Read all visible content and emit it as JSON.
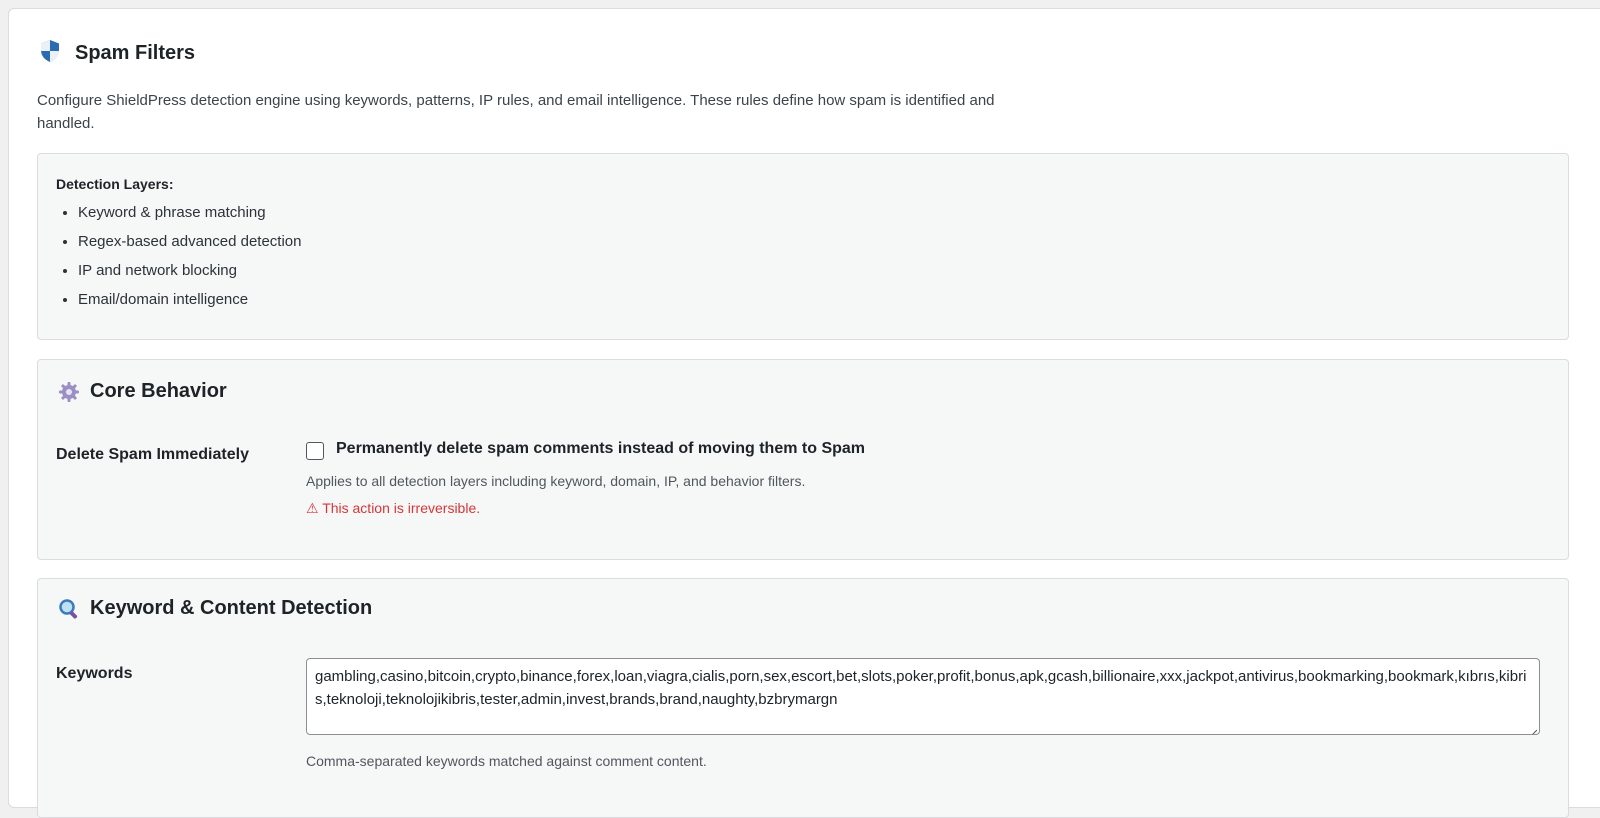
{
  "page": {
    "title": "Spam Filters",
    "description": "Configure ShieldPress detection engine using keywords, patterns, IP rules, and email intelligence. These rules define how spam is identified and handled.",
    "icon": "shield-icon"
  },
  "layers": {
    "title": "Detection Layers:",
    "items": [
      "Keyword & phrase matching",
      "Regex-based advanced detection",
      "IP and network blocking",
      "Email/domain intelligence"
    ]
  },
  "core": {
    "title": "Core Behavior",
    "icon": "gear-icon",
    "delete_label": "Delete Spam Immediately",
    "checkbox_label": "Permanently delete spam comments instead of moving them to Spam",
    "checkbox_checked": false,
    "help": "Applies to all detection layers including keyword, domain, IP, and behavior filters.",
    "warning": "⚠ This action is irreversible."
  },
  "keywords": {
    "title": "Keyword & Content Detection",
    "icon": "magnifier-icon",
    "label": "Keywords",
    "value": "gambling,casino,bitcoin,crypto,binance,forex,loan,viagra,cialis,porn,sex,escort,bet,slots,poker,profit,bonus,apk,gcash,billionaire,xxx,jackpot,antivirus,bookmarking,bookmark,kıbrıs,kibris,teknoloji,teknolojikibris,tester,admin,invest,brands,brand,naughty,bzbrymargn",
    "help": "Comma-separated keywords matched against comment content."
  },
  "colors": {
    "accent": "#2271b1",
    "warning": "#d63638",
    "card_bg": "#f6f7f7"
  }
}
